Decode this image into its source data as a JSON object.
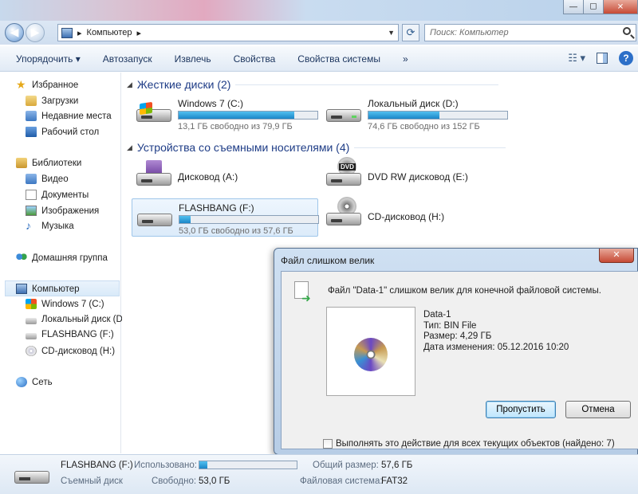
{
  "titlebar": {
    "minimize": "—",
    "maximize": "☐",
    "close": "✕"
  },
  "address": {
    "path": "Компьютер",
    "separator": "▸",
    "search_placeholder": "Поиск: Компьютер"
  },
  "toolbar": {
    "organize": "Упорядочить ▾",
    "autoplay": "Автозапуск",
    "eject": "Извлечь",
    "properties": "Свойства",
    "system_properties": "Свойства системы",
    "more": "»"
  },
  "sidebar": {
    "favorites": "Избранное",
    "downloads": "Загрузки",
    "recent": "Недавние места",
    "desktop": "Рабочий стол",
    "libraries": "Библиотеки",
    "video": "Видео",
    "documents": "Документы",
    "images": "Изображения",
    "music": "Музыка",
    "homegroup": "Домашняя группа",
    "computer": "Компьютер",
    "drive_c": "Windows 7 (C:)",
    "drive_d": "Локальный диск (D",
    "drive_f": "FLASHBANG (F:)",
    "drive_h": "CD-дисковод (H:)",
    "network": "Сеть"
  },
  "main": {
    "hdd_header": "Жесткие диски (2)",
    "removable_header": "Устройства со съемными носителями (4)",
    "drives": [
      {
        "name": "Windows 7 (C:)",
        "free": "13,1 ГБ свободно из 79,9 ГБ",
        "used_fraction": 0.836
      },
      {
        "name": "Локальный диск (D:)",
        "free": "74,6 ГБ свободно из 152 ГБ",
        "used_fraction": 0.509
      },
      {
        "name": "Дисковод (A:)"
      },
      {
        "name": "DVD RW дисковод (E:)"
      },
      {
        "name": "FLASHBANG (F:)",
        "free": "53,0 ГБ свободно из 57,6 ГБ",
        "used_fraction": 0.08
      },
      {
        "name": "CD-дисковод (H:)"
      }
    ]
  },
  "dialog": {
    "title": "Файл слишком велик",
    "close": "✕",
    "message": "Файл \"Data-1\" слишком велик для конечной файловой системы.",
    "file_name": "Data-1",
    "file_type": "Тип: BIN File",
    "file_size": "Размер: 4,29 ГБ",
    "file_date": "Дата изменения: 05.12.2016 10:20",
    "skip": "Пропустить",
    "cancel": "Отмена",
    "apply_all": "Выполнять это действие для всех текущих объектов (найдено: 7)"
  },
  "details": {
    "name": "FLASHBANG (F:)",
    "type": "Съемный диск",
    "used_label": "Использовано:",
    "free_label": "Свободно:",
    "free_value": "53,0 ГБ",
    "total_label": "Общий размер:",
    "total_value": "57,6 ГБ",
    "fs_label": "Файловая система:",
    "fs_value": "FAT32",
    "used_fraction": 0.08
  }
}
